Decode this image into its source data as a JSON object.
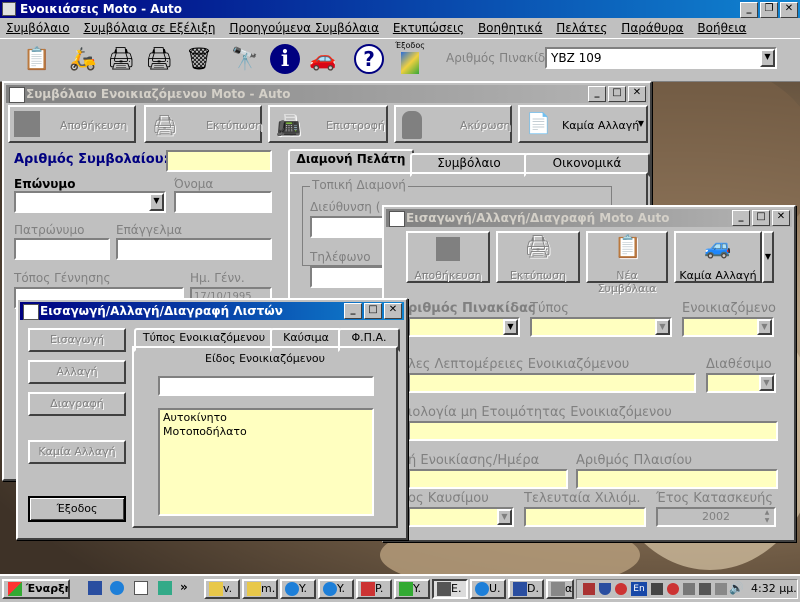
{
  "app": {
    "title": "Ενοικιάσεις Moto - Auto",
    "menu": [
      "Συμβόλαιο",
      "Συμβόλαια σε Εξέλιξη",
      "Προηγούμενα Συμβόλαια",
      "Εκτυπώσεις",
      "Βοηθητικά",
      "Πελάτες",
      "Παράθυρα",
      "Βοήθεια"
    ],
    "toolbar": {
      "exodos_label": "Έξοδος",
      "plate_label": "Αριθμός Πινακίδας:",
      "plate_value": "YBZ 109"
    }
  },
  "contract_window": {
    "title": "Συμβόλαιο Ενοικιαζόμενου Moto - Auto",
    "buttons": [
      "Αποθήκευση",
      "Εκτύπωση",
      "Επιστροφή",
      "Ακύρωση",
      "Καμία Αλλαγή"
    ],
    "contract_no_label": "Αριθμός Συμβολαίου:",
    "surname_label": "Επώνυμο",
    "name_label": "Όνομα",
    "father_label": "Πατρώνυμο",
    "profession_label": "Επάγγελμα",
    "birthplace_label": "Τόπος Γέννησης",
    "birthdate_label": "Ημ. Γένν.",
    "birthdate_value": "17/10/1995",
    "tabs": [
      "Διαμονή Πελάτη",
      "Συμβόλαιο",
      "Οικονομικά"
    ],
    "local_residence": "Τοπική Διαμονή",
    "address_label": "Διεύθυνση (",
    "phone_label": "Τηλέφωνο"
  },
  "vehicle_window": {
    "title": "Εισαγωγή/Αλλαγή/Διαγραφή Moto Auto",
    "buttons": [
      "Αποθήκευση",
      "Εκτύπωση",
      "Νέα Συμβόλαια",
      "Καμία Αλλαγή"
    ],
    "plate_label": "ριθμός Πινακίδας",
    "type_label": "Τύπος",
    "rented_label": "Ενοικιαζόμενο",
    "details_label": "λες Λεπτομέρειες Ενοικιαζόμενου",
    "available_label": "Διαθέσιμο",
    "reason_label": "ιολογία μη Ετοιμότητας Ενοικιαζόμενου",
    "rent_day_label": "ή Ενοικίασης/Ημέρα",
    "chassis_label": "Αριθμός Πλαισίου",
    "fuel_label": "ος Καυσίμου",
    "last_km_label": "Τελευταία Χιλιόμ.",
    "year_label": "Έτος Κατασκευής",
    "year_value": "2002"
  },
  "lists_window": {
    "title": "Εισαγωγή/Αλλαγή/Διαγραφή Λιστών",
    "buttons": [
      "Εισαγωγή",
      "Αλλαγή",
      "Διαγραφή",
      "Καμία Αλλαγή",
      "Έξοδος"
    ],
    "tabs": [
      "Τύπος Ενοικιαζόμενου",
      "Καύσιμα",
      "Φ.Π.Α."
    ],
    "group_label": "Είδος Ενοικιαζόμενου",
    "input_value": "",
    "items": [
      "Αυτοκίνητο",
      "Μοτοποδήλατο"
    ]
  },
  "taskbar": {
    "start_label": "Έναρξη",
    "tasks": [
      "v.",
      "m.",
      "Y.",
      "Y.",
      "P.",
      "Y.",
      "E.",
      "U.",
      "D.",
      "α."
    ],
    "clock": "4:32 μμ."
  },
  "colors": {
    "title_active": "#000080",
    "field_yellow": "#ffffc0",
    "window_gray": "#c0c0c0"
  }
}
